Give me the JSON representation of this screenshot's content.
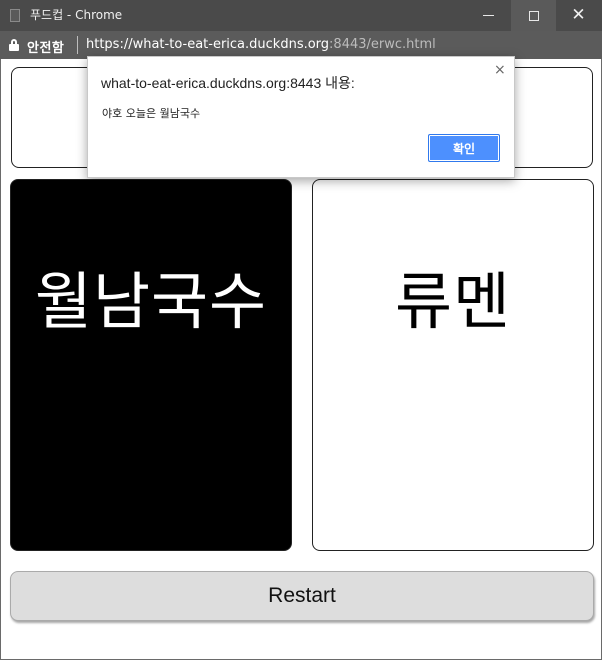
{
  "window": {
    "title": "푸드컵 - Chrome",
    "icons": {
      "page": "page-icon",
      "minimize": "minimize-icon",
      "maximize": "maximize-icon",
      "close": "close-icon",
      "close_glyph": "✕"
    }
  },
  "addressbar": {
    "security_label": "안전함",
    "url_host": "https://what-to-eat-erica.duckdns.org",
    "url_rest": ":8443/erwc.html",
    "lock_icon": "lock-icon"
  },
  "page": {
    "cards": [
      {
        "label": "월남국수",
        "background": "#000000",
        "color": "#ffffff"
      },
      {
        "label": "류멘",
        "background": "#ffffff",
        "color": "#000000"
      }
    ],
    "restart_label": "Restart"
  },
  "dialog": {
    "title": "what-to-eat-erica.duckdns.org:8443 내용:",
    "message": "야호 오늘은 월남국수",
    "ok_label": "확인",
    "close_glyph": "×",
    "accent": "#4d90fe"
  }
}
